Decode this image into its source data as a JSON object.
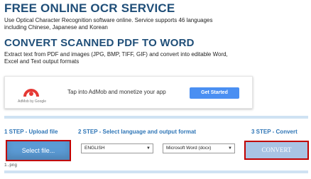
{
  "header": {
    "title": "FREE ONLINE OCR SERVICE",
    "description": "Use Optical Character Recognition software online. Service supports 46 languages including Chinese, Japanese and Korean"
  },
  "section": {
    "title": "CONVERT SCANNED PDF TO WORD",
    "description": "Extract text from PDF and images (JPG, BMP, TIFF, GIF) and convert into editable Word, Excel and Text output formats"
  },
  "ad": {
    "brand": "AdMob by Google",
    "text": "Tap into AdMob and monetize your app",
    "cta": "Get Started"
  },
  "steps": {
    "step1_label": "1 STEP - Upload file",
    "step2_label": "2 STEP - Select language and output format",
    "step3_label": "3 STEP - Convert"
  },
  "upload": {
    "button_label": "Select file...",
    "filename": "1.png"
  },
  "language_select": {
    "value": "ENGLISH"
  },
  "format_select": {
    "value": "Microsoft Word (docx)"
  },
  "convert": {
    "button_label": "CONVERT"
  },
  "colors": {
    "title": "#1f4e78",
    "step_label": "#2e75b6",
    "upload_button": "#5b9bd5",
    "convert_button": "#a9c4e4",
    "highlight_border": "#c00000"
  }
}
